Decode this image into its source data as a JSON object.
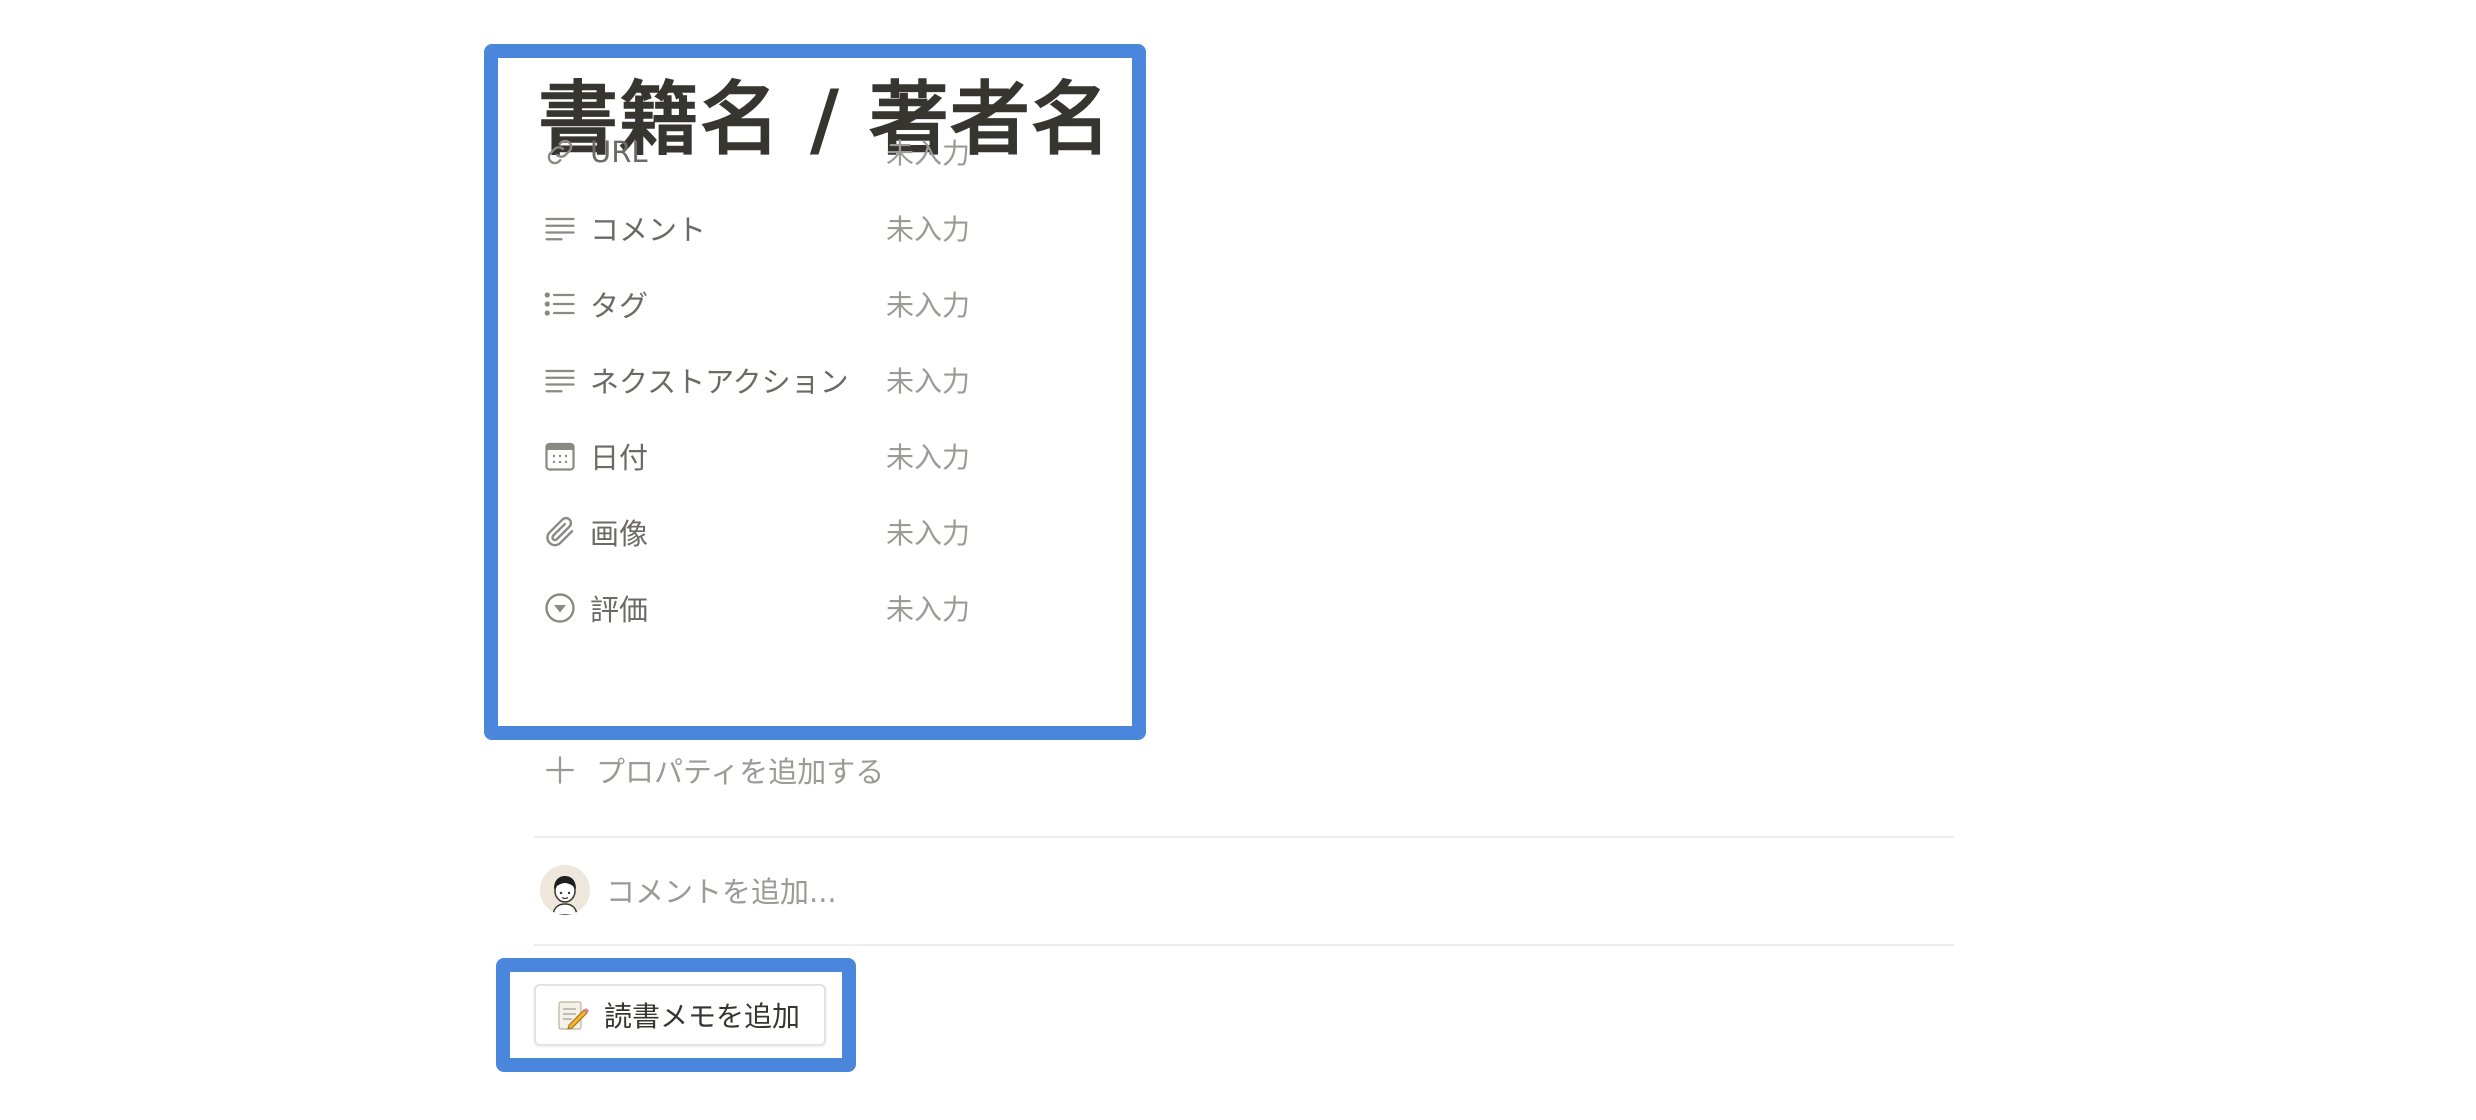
{
  "page": {
    "title": "書籍名 / 著者名"
  },
  "properties": [
    {
      "name": "URL",
      "icon": "link-icon",
      "value": "未入力"
    },
    {
      "name": "コメント",
      "icon": "text-lines-icon",
      "value": "未入力"
    },
    {
      "name": "タグ",
      "icon": "bulleted-list-icon",
      "value": "未入力"
    },
    {
      "name": "ネクストアクション",
      "icon": "text-lines-icon",
      "value": "未入力"
    },
    {
      "name": "日付",
      "icon": "calendar-icon",
      "value": "未入力"
    },
    {
      "name": "画像",
      "icon": "paperclip-icon",
      "value": "未入力"
    },
    {
      "name": "評価",
      "icon": "select-circle-icon",
      "value": "未入力"
    }
  ],
  "add_property": {
    "icon": "plus-icon",
    "label": "プロパティを追加する"
  },
  "comment": {
    "avatar": "avatar",
    "placeholder": "コメントを追加..."
  },
  "template_button": {
    "icon": "memo-icon",
    "label": "読書メモを追加"
  },
  "colors": {
    "highlight": "#4a86dc",
    "text": "#37352f",
    "muted": "#9b9a97"
  }
}
